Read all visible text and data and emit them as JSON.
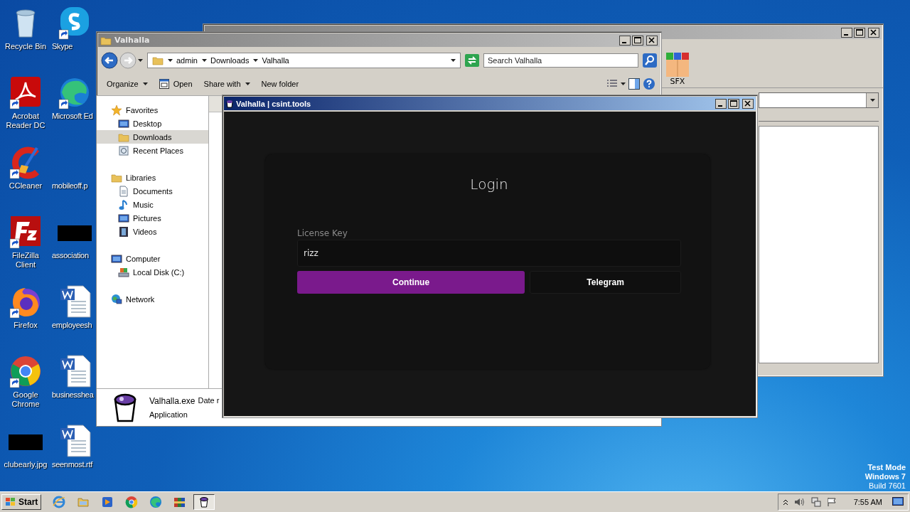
{
  "desktop": {
    "icons": [
      {
        "label": "Recycle Bin",
        "kind": "trash",
        "shortcut": false
      },
      {
        "label": "Skype",
        "kind": "blob",
        "shortcut": true
      },
      {
        "label": "Acrobat Reader DC",
        "kind": "swirl",
        "shortcut": true
      },
      {
        "label": "Microsoft Ed",
        "kind": "wave",
        "shortcut": true
      },
      {
        "label": "CCleaner",
        "kind": "brush",
        "shortcut": true
      },
      {
        "label": "mobileoff.p",
        "kind": "none"
      },
      {
        "label": "FileZilla Client",
        "kind": "tile",
        "shortcut": true
      },
      {
        "label": "association",
        "kind": "thumb",
        "shortcut": false
      },
      {
        "label": "Firefox",
        "kind": "flame",
        "shortcut": true
      },
      {
        "label": "employeesh",
        "kind": "doc",
        "shortcut": false
      },
      {
        "label": "Google Chrome",
        "kind": "globe",
        "shortcut": true
      },
      {
        "label": "businesshea",
        "kind": "doc",
        "shortcut": false
      },
      {
        "label": "clubearly.jpg",
        "kind": "thumb",
        "shortcut": false
      },
      {
        "label": "seenmost.rtf",
        "kind": "doc",
        "shortcut": false
      }
    ],
    "corner_text": [
      "Test Mode",
      "Windows 7",
      "Build 7601"
    ]
  },
  "back_window": {
    "toolbar": [
      {
        "label": "SFX"
      }
    ]
  },
  "explorer": {
    "title": "Valhalla",
    "breadcrumb": [
      "admin",
      "Downloads",
      "Valhalla"
    ],
    "search": {
      "placeholder": "Search Valhalla"
    },
    "toolbar": [
      {
        "label": "Organize",
        "kind": "menu"
      },
      {
        "label": "Open",
        "kind": "icon"
      },
      {
        "label": "Share with",
        "kind": "menu"
      },
      {
        "label": "New folder",
        "kind": "plain"
      }
    ],
    "sidebar": [
      {
        "label": "Favorites",
        "kind": "star",
        "selected": false,
        "children": [
          {
            "label": "Desktop",
            "kind": "screen",
            "selected": false
          },
          {
            "label": "Downloads",
            "kind": "folder",
            "selected": true
          },
          {
            "label": "Recent Places",
            "kind": "recent",
            "selected": false
          }
        ]
      },
      {
        "label": "Libraries",
        "kind": "folder",
        "selected": false,
        "children": [
          {
            "label": "Documents",
            "kind": "page",
            "selected": false
          },
          {
            "label": "Music",
            "kind": "note",
            "selected": false
          },
          {
            "label": "Pictures",
            "kind": "screen",
            "selected": false
          },
          {
            "label": "Videos",
            "kind": "film",
            "selected": false
          }
        ]
      },
      {
        "label": "Computer",
        "kind": "screen",
        "selected": false,
        "children": [
          {
            "label": "Local Disk (C:)",
            "kind": "disk",
            "selected": false
          }
        ]
      },
      {
        "label": "Network",
        "kind": "globe",
        "selected": false
      }
    ],
    "details": {
      "name": "Valhalla.exe",
      "date_label": "Date r",
      "type": "Application"
    }
  },
  "app": {
    "title": "Valhalla | csint.tools",
    "heading": "Login",
    "field": {
      "label": "License Key",
      "value": "rizz"
    },
    "buttons": [
      {
        "label": "Continue",
        "kind": "primary"
      },
      {
        "label": "Telegram",
        "kind": "secondary"
      }
    ]
  },
  "taskbar": {
    "start": "Start",
    "items": [
      {
        "kind": "ie",
        "selected": false
      },
      {
        "kind": "folder",
        "selected": false
      },
      {
        "kind": "media",
        "selected": false
      },
      {
        "kind": "globe",
        "selected": false
      },
      {
        "kind": "wave",
        "selected": false
      },
      {
        "kind": "books",
        "selected": false
      },
      {
        "kind": "bucket",
        "selected": true
      }
    ],
    "clock": "7:55 AM"
  }
}
